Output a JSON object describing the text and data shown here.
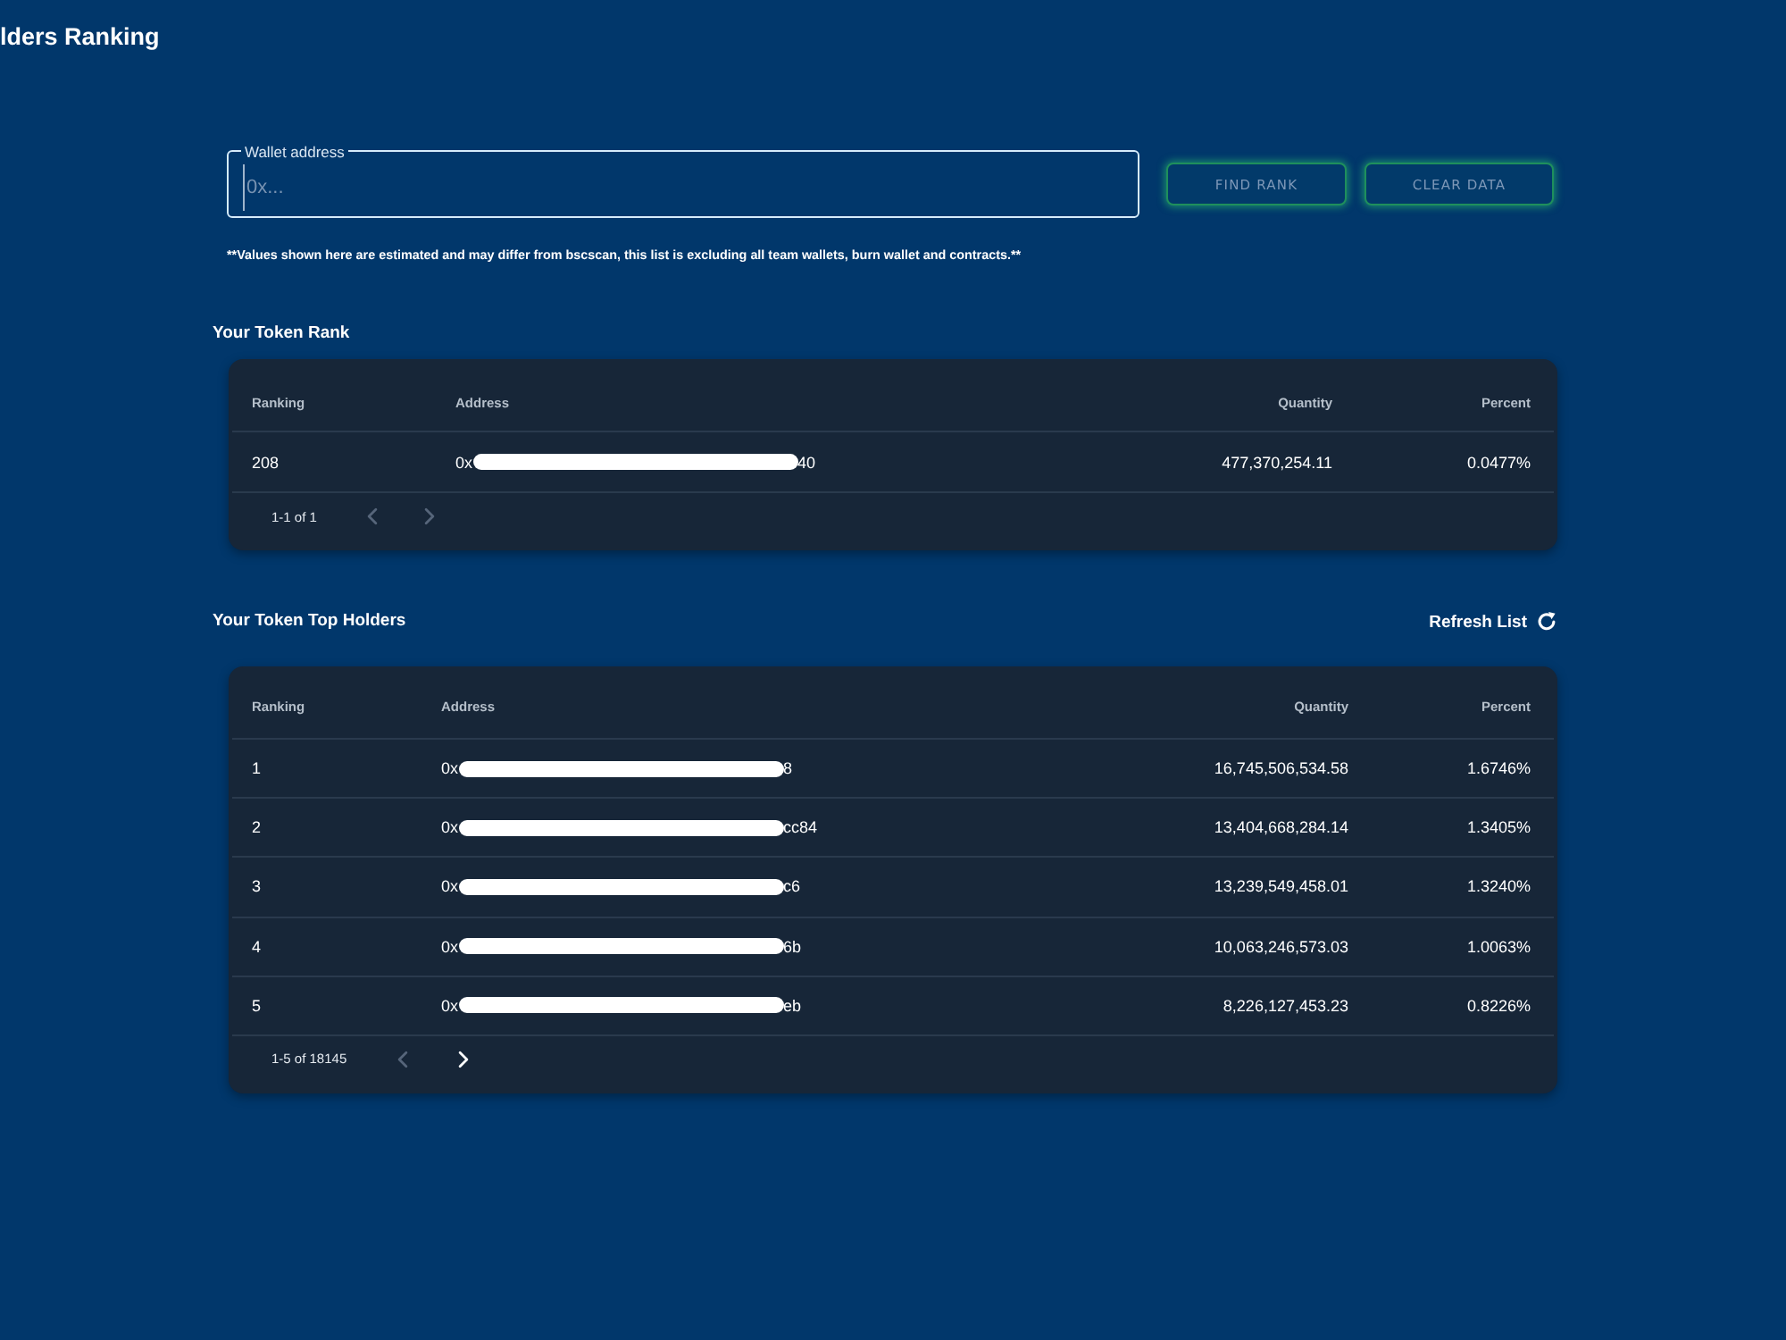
{
  "page": {
    "title": "lders Ranking"
  },
  "wallet_search": {
    "label": "Wallet address",
    "placeholder": "0x..."
  },
  "buttons": [
    {
      "label": "FIND RANK"
    },
    {
      "label": "CLEAR DATA"
    }
  ],
  "disclaimer": "**Values shown here are estimated and may differ from bscscan, this list is excluding all team wallets, burn wallet and contracts.**",
  "rank_section": {
    "title": "Your Token Rank",
    "columns": [
      "Ranking",
      "Address",
      "Quantity",
      "Percent"
    ],
    "rows": [
      {
        "ranking": "208",
        "address_prefix": "0x",
        "redacted": true,
        "address_suffix": "40",
        "quantity": "477,370,254.11",
        "percent": "0.0477%"
      }
    ],
    "pagination": {
      "range": "1-1 of 1",
      "previous_disabled": true,
      "next_disabled": true
    }
  },
  "holders_section": {
    "title": "Your Token Top Holders",
    "refresh": "Refresh List",
    "columns": [
      "Ranking",
      "Address",
      "Quantity",
      "Percent"
    ],
    "rows": [
      {
        "ranking": "1",
        "address_prefix": "0x",
        "redacted": true,
        "address_suffix": "8",
        "quantity": "16,745,506,534.58",
        "percent": "1.6746%"
      },
      {
        "ranking": "2",
        "address_prefix": "0x",
        "redacted": true,
        "address_suffix": "cc84",
        "quantity": "13,404,668,284.14",
        "percent": "1.3405%"
      },
      {
        "ranking": "3",
        "address_prefix": "0x",
        "redacted": true,
        "address_suffix": "c6",
        "quantity": "13,239,549,458.01",
        "percent": "1.3240%"
      },
      {
        "ranking": "4",
        "address_prefix": "0x",
        "redacted": true,
        "address_suffix": "6b",
        "quantity": "10,063,246,573.03",
        "percent": "1.0063%"
      },
      {
        "ranking": "5",
        "address_prefix": "0x",
        "redacted": true,
        "address_suffix": "eb",
        "quantity": "8,226,127,453.23",
        "percent": "0.8226%"
      }
    ],
    "pagination": {
      "range": "1-5 of 18145",
      "previous_disabled": true,
      "next_disabled": false
    }
  }
}
